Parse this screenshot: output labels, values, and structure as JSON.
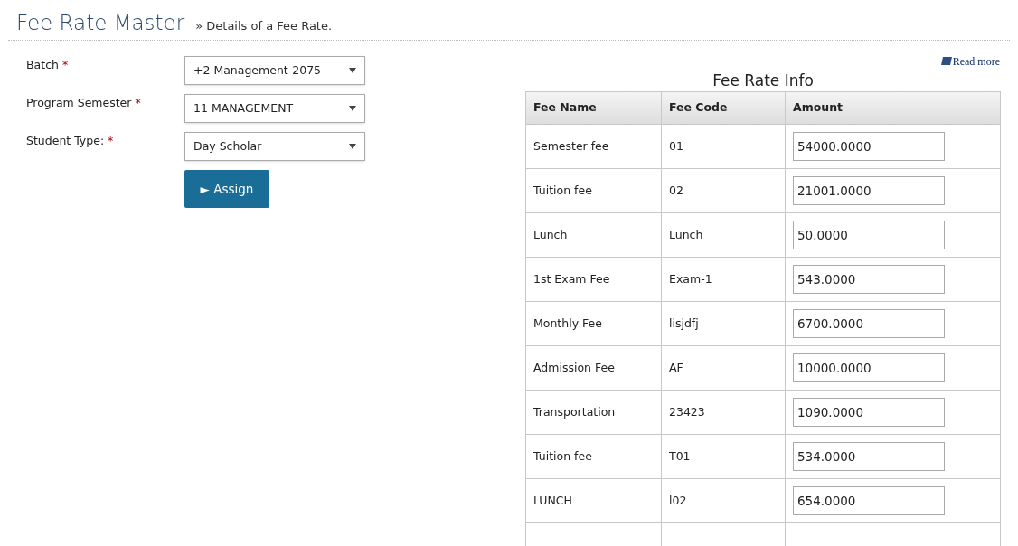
{
  "header": {
    "title": "Fee Rate Master",
    "subtitle": "» Details of a Fee Rate."
  },
  "form": {
    "fields": [
      {
        "label": "Batch",
        "required_mark": "*",
        "value": "+2 Management-2075"
      },
      {
        "label": "Program Semester",
        "required_mark": "*",
        "value": "11 MANAGEMENT"
      },
      {
        "label": "Student Type:",
        "required_mark": "*",
        "value": "Day Scholar"
      }
    ],
    "button": {
      "icon": "►",
      "label": "Assign"
    }
  },
  "read_more": "Read more",
  "table": {
    "title": "Fee Rate Info",
    "columns": [
      "Fee Name",
      "Fee Code",
      "Amount"
    ],
    "rows": [
      {
        "name": "Semester fee",
        "code": "01",
        "amount": "54000.0000"
      },
      {
        "name": "Tuition fee",
        "code": "02",
        "amount": "21001.0000"
      },
      {
        "name": "Lunch",
        "code": "Lunch",
        "amount": "50.0000"
      },
      {
        "name": "1st Exam Fee",
        "code": "Exam-1",
        "amount": "543.0000"
      },
      {
        "name": "Monthly Fee",
        "code": "lisjdfj",
        "amount": "6700.0000"
      },
      {
        "name": "Admission Fee",
        "code": "AF",
        "amount": "10000.0000"
      },
      {
        "name": "Transportation",
        "code": "23423",
        "amount": "1090.0000"
      },
      {
        "name": "Tuition fee",
        "code": "T01",
        "amount": "534.0000"
      },
      {
        "name": "LUNCH",
        "code": "l02",
        "amount": "654.0000"
      }
    ]
  }
}
